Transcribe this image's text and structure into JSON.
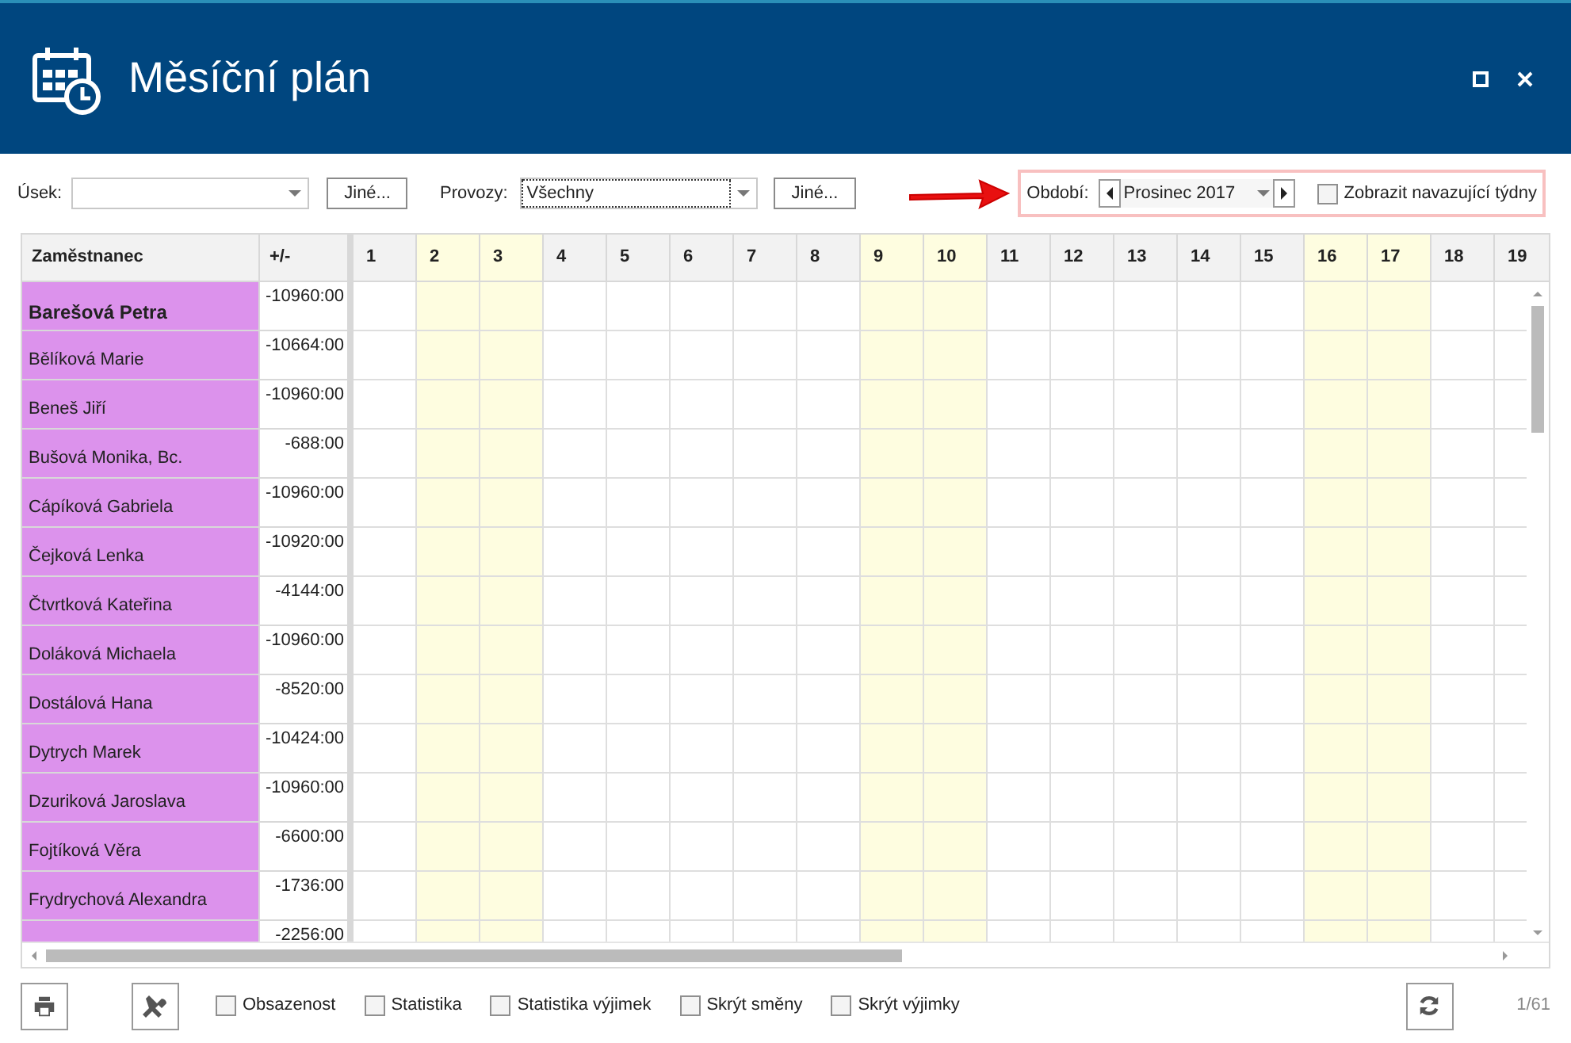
{
  "window": {
    "title": "Měsíční plán"
  },
  "filters": {
    "usek_label": "Úsek:",
    "usek_button": "Jiné...",
    "provozy_label": "Provozy:",
    "provozy_value": "Všechny",
    "provozy_button": "Jiné...",
    "period_label": "Období:",
    "period_value": "Prosinec 2017",
    "following_weeks": {
      "label": "Zobrazit navazující týdny",
      "checked": false
    }
  },
  "table": {
    "columns": [
      "Zaměstnanec",
      "+/-"
    ],
    "days": [
      {
        "label": "1",
        "weekend": false
      },
      {
        "label": "2",
        "weekend": true
      },
      {
        "label": "3",
        "weekend": true
      },
      {
        "label": "4",
        "weekend": false
      },
      {
        "label": "5",
        "weekend": false
      },
      {
        "label": "6",
        "weekend": false
      },
      {
        "label": "7",
        "weekend": false
      },
      {
        "label": "8",
        "weekend": false
      },
      {
        "label": "9",
        "weekend": true
      },
      {
        "label": "10",
        "weekend": true
      },
      {
        "label": "11",
        "weekend": false
      },
      {
        "label": "12",
        "weekend": false
      },
      {
        "label": "13",
        "weekend": false
      },
      {
        "label": "14",
        "weekend": false
      },
      {
        "label": "15",
        "weekend": false
      },
      {
        "label": "16",
        "weekend": true
      },
      {
        "label": "17",
        "weekend": true
      },
      {
        "label": "18",
        "weekend": false
      },
      {
        "label": "19",
        "weekend": false
      }
    ],
    "rows": [
      {
        "name": "Barešová Petra",
        "balance": "-10960:00",
        "selected": true
      },
      {
        "name": "Bělíková Marie",
        "balance": "-10664:00",
        "selected": false
      },
      {
        "name": "Beneš Jiří",
        "balance": "-10960:00",
        "selected": false
      },
      {
        "name": "Bušová Monika, Bc.",
        "balance": "-688:00",
        "selected": false
      },
      {
        "name": "Cápíková Gabriela",
        "balance": "-10960:00",
        "selected": false
      },
      {
        "name": "Čejková Lenka",
        "balance": "-10920:00",
        "selected": false
      },
      {
        "name": "Čtvrtková Kateřina",
        "balance": "-4144:00",
        "selected": false
      },
      {
        "name": "Doláková Michaela",
        "balance": "-10960:00",
        "selected": false
      },
      {
        "name": "Dostálová Hana",
        "balance": "-8520:00",
        "selected": false
      },
      {
        "name": "Dytrych Marek",
        "balance": "-10424:00",
        "selected": false
      },
      {
        "name": "Dzuriková Jaroslava",
        "balance": "-10960:00",
        "selected": false
      },
      {
        "name": "Fojtíková Věra",
        "balance": "-6600:00",
        "selected": false
      },
      {
        "name": "Frydrychová Alexandra",
        "balance": "-1736:00",
        "selected": false
      },
      {
        "balance": "-2256:00"
      }
    ]
  },
  "options": [
    {
      "label": "Obsazenost",
      "checked": false
    },
    {
      "label": "Statistika",
      "checked": false
    },
    {
      "label": "Statistika výjimek",
      "checked": false
    },
    {
      "label": "Skrýt směny",
      "checked": false
    },
    {
      "label": "Skrýt výjimky",
      "checked": false
    }
  ],
  "page_counter": "1/61"
}
